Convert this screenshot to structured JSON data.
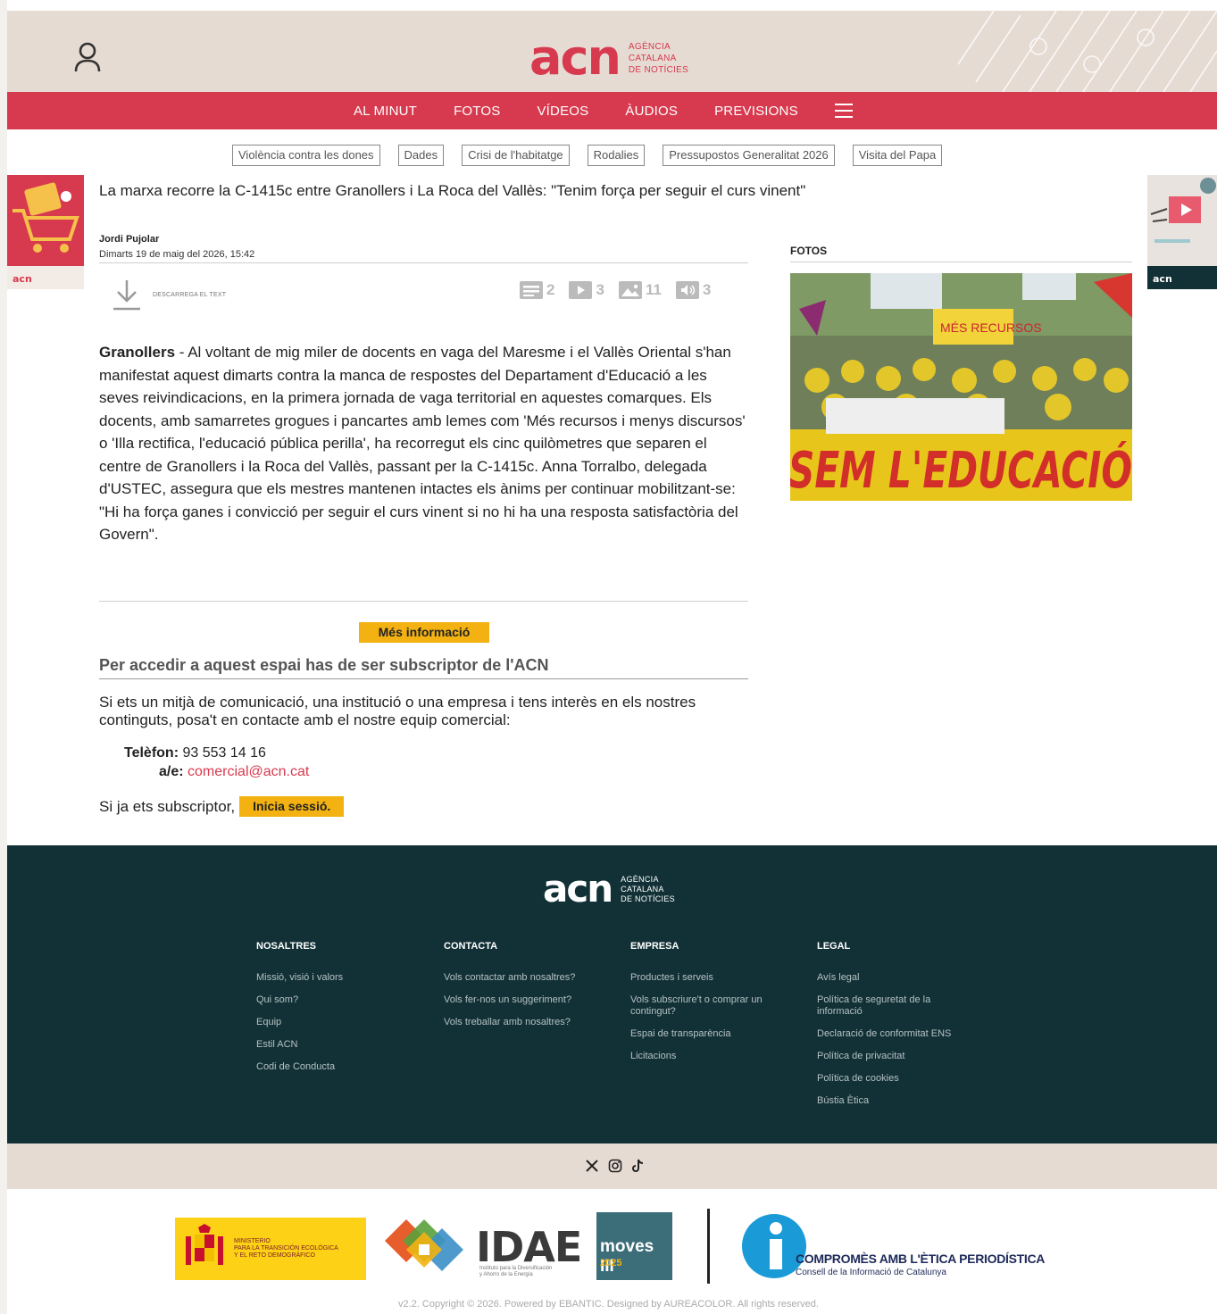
{
  "header": {
    "logo_mark": "acn",
    "logo_text_1": "AGÈNCIA",
    "logo_text_2": "CATALANA",
    "logo_text_3": "DE NOTÍCIES"
  },
  "nav": {
    "items": [
      "AL MINUT",
      "FOTOS",
      "VÍDEOS",
      "ÀUDIOS",
      "PREVISIONS"
    ]
  },
  "tags": [
    "Violència contra les dones",
    "Dades",
    "Crisi de l'habitatge",
    "Rodalies",
    "Pressupostos Generalitat 2026",
    "Visita del Papa"
  ],
  "ads": {
    "left_label": "acn",
    "right_label": "acn"
  },
  "article": {
    "headline": "La marxa recorre la C-1415c entre Granollers i La Roca del Vallès: \"Tenim força per seguir el curs vinent\"",
    "author": "Jordi Pujolar",
    "date": "Dimarts 19 de maig del 2026, 15:42",
    "download_label": "DESCARREGA EL TEXT",
    "counts": {
      "texts": "2",
      "videos": "3",
      "photos": "11",
      "audios": "3"
    },
    "location": "Granollers",
    "body": " - Al voltant de mig miler de docents en vaga del Maresme i el Vallès Oriental s'han manifestat aquest dimarts contra la manca de respostes del Departament d'Educació a les seves reivindicacions, en la primera jornada de vaga territorial en aquestes comarques. Els docents, amb samarretes grogues i pancartes amb lemes com 'Més recursos i menys discursos' o 'Illa rectifica, l'educació pública perilla', ha recorregut els cinc quilòmetres que separen el centre de Granollers i la Roca del Vallès, passant per la C-1415c. Anna Torralbo, delegada d'USTEC, assegura que els mestres mantenen intactes els ànims per continuar mobilitzant-se: \"Hi ha força ganes i convicció per seguir el curs vinent si no hi ha una resposta satisfactòria del Govern\"."
  },
  "subscription": {
    "more_button": "Més informació",
    "title": "Per accedir a aquest espai has de ser subscriptor de l'ACN",
    "text": "Si ets un mitjà de comunicació, una institució o una empresa i tens interès en els nostres continguts, posa't en contacte amb el nostre equip comercial:",
    "phone_label": "Telèfon:",
    "phone_value": " 93 553 14 16",
    "mail_label": "a/e:",
    "mail_value": "comercial@acn.cat",
    "already_text": "Si ja ets subscriptor,",
    "login_button": "Inicia sessió."
  },
  "photos": {
    "title": "FOTOS",
    "banner_text": "SEM L'EDUCACIÓ",
    "sign_text": "MÉS RECURSOS"
  },
  "footer": {
    "columns": [
      {
        "title": "NOSALTRES",
        "links": [
          "Missió, visió i valors",
          "Qui som?",
          "Equip",
          "Estil ACN",
          "Codi de Conducta"
        ]
      },
      {
        "title": "CONTACTA",
        "links": [
          "Vols contactar amb nosaltres?",
          "Vols fer-nos un suggeriment?",
          "Vols treballar amb nosaltres?"
        ]
      },
      {
        "title": "EMPRESA",
        "links": [
          "Productes i serveis",
          "Vols subscriure't o comprar un contingut?",
          "Espai de transparència",
          "Licitacions"
        ]
      },
      {
        "title": "LEGAL",
        "links": [
          "Avís legal",
          "Política de seguretat de la informació",
          "Declaració de conformitat ENS",
          "Política de privacitat",
          "Política de cookies",
          "Bústia Ètica"
        ]
      }
    ],
    "social": [
      "x-icon",
      "instagram-icon",
      "tiktok-icon"
    ]
  },
  "sponsors": {
    "ministerio_1": "MINISTERIO",
    "ministerio_2": "PARA LA TRANSICIÓN ECOLÓGICA",
    "ministerio_3": "Y EL RETO DEMOGRÁFICO",
    "idae": "IDAE",
    "idae_sub_1": "Instituto para la Diversificación",
    "idae_sub_2": "y Ahorro de la Energía",
    "moves": "moves III",
    "moves_year": "2025",
    "etica_title": "COMPROMÈS AMB L'ÈTICA PERIODÍSTICA",
    "etica_sub": "Consell de la Informació de Catalunya"
  },
  "copyright": "v2.2. Copyright © 2026. Powered by EBANTIC. Designed by AUREACOLOR. All rights reserved.",
  "colors": {
    "brand_red": "#d73a4f",
    "footer_dark": "#123136",
    "beige": "#e6dbd3",
    "accent_yellow": "#f3b212"
  }
}
